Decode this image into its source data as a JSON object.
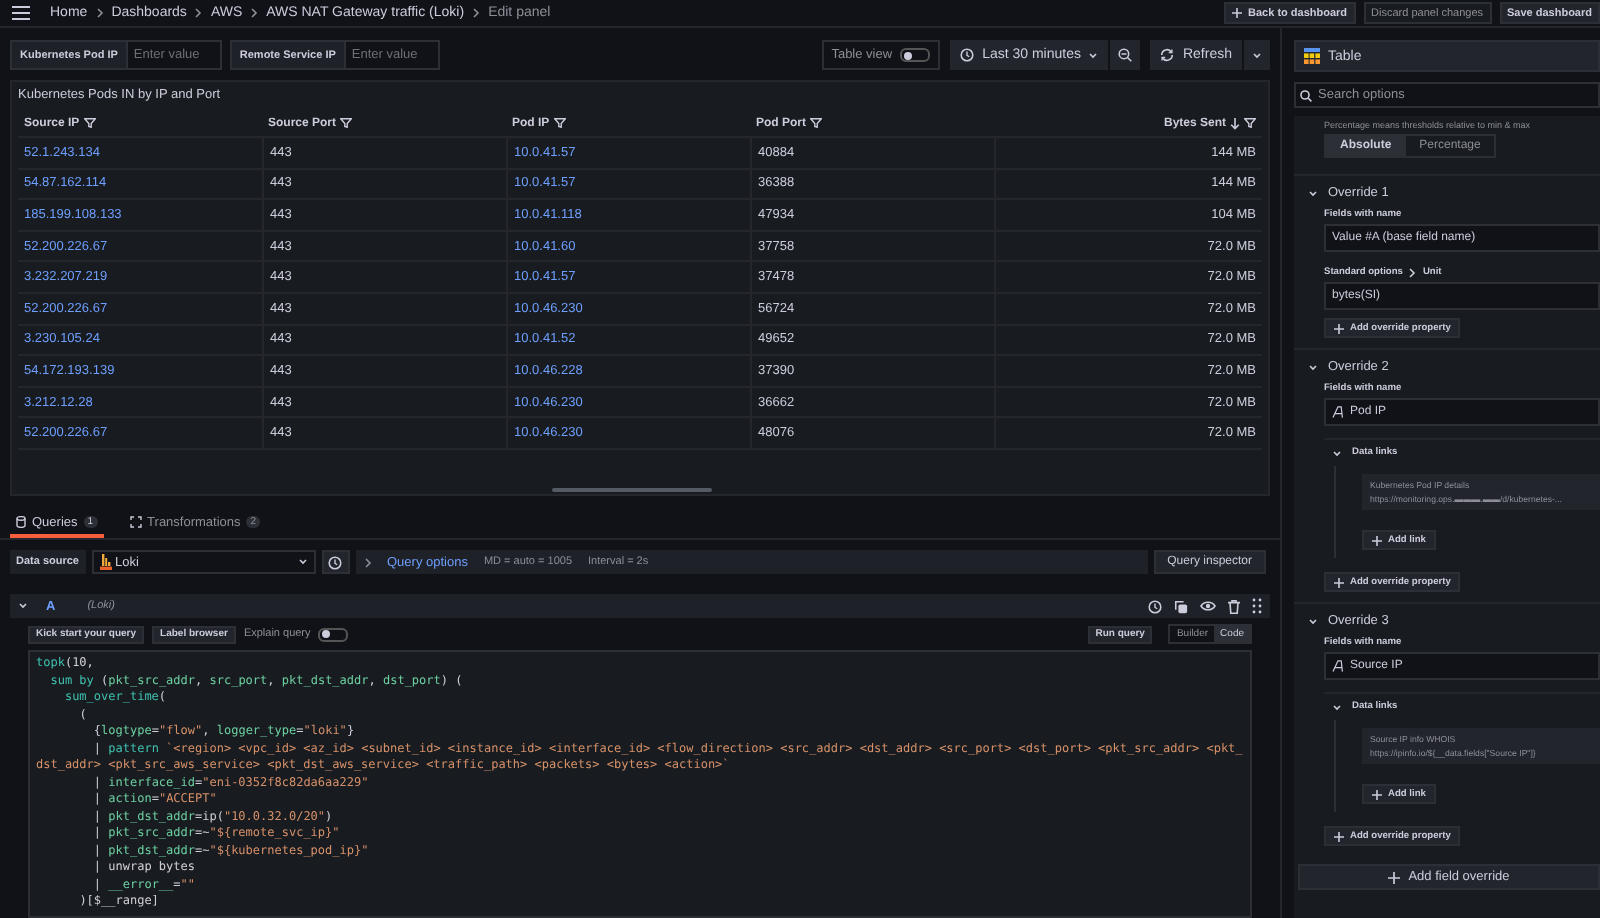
{
  "breadcrumbs": [
    "Home",
    "Dashboards",
    "AWS",
    "AWS NAT Gateway traffic (Loki)",
    "Edit panel"
  ],
  "top_actions": [
    {
      "label": "Back to dashboard",
      "kind": "add"
    },
    {
      "label": "Discard panel changes",
      "kind": "plain"
    },
    {
      "label": "Save dashboard",
      "kind": "plain"
    }
  ],
  "variables": [
    {
      "label": "Kubernetes Pod IP",
      "placeholder": "Enter value"
    },
    {
      "label": "Remote Service IP",
      "placeholder": "Enter value"
    }
  ],
  "table_view": {
    "label": "Table view",
    "on": false
  },
  "time_picker": {
    "label": "Last 30 minutes"
  },
  "refresh": {
    "label": "Refresh"
  },
  "panel": {
    "title": "Kubernetes Pods IN by IP and Port",
    "columns": [
      {
        "label": "Source IP",
        "kind": "link"
      },
      {
        "label": "Source Port",
        "kind": "text"
      },
      {
        "label": "Pod IP",
        "kind": "link"
      },
      {
        "label": "Pod Port",
        "kind": "text"
      },
      {
        "label": "Bytes Sent",
        "kind": "number",
        "sorted_descending": true
      }
    ],
    "rows": [
      [
        "52.1.243.134",
        "443",
        "10.0.41.57",
        "40884",
        "144 MB"
      ],
      [
        "54.87.162.114",
        "443",
        "10.0.41.57",
        "36388",
        "144 MB"
      ],
      [
        "185.199.108.133",
        "443",
        "10.0.41.118",
        "47934",
        "104 MB"
      ],
      [
        "52.200.226.67",
        "443",
        "10.0.41.60",
        "37758",
        "72.0 MB"
      ],
      [
        "3.232.207.219",
        "443",
        "10.0.41.57",
        "37478",
        "72.0 MB"
      ],
      [
        "52.200.226.67",
        "443",
        "10.0.46.230",
        "56724",
        "72.0 MB"
      ],
      [
        "3.230.105.24",
        "443",
        "10.0.41.52",
        "49652",
        "72.0 MB"
      ],
      [
        "54.172.193.139",
        "443",
        "10.0.46.228",
        "37390",
        "72.0 MB"
      ],
      [
        "3.212.12.28",
        "443",
        "10.0.46.230",
        "36662",
        "72.0 MB"
      ],
      [
        "52.200.226.67",
        "443",
        "10.0.46.230",
        "48076",
        "72.0 MB"
      ]
    ]
  },
  "query_tabs": [
    {
      "label": "Queries",
      "count": "1",
      "selected": true
    },
    {
      "label": "Transformations",
      "count": "2",
      "selected": false
    }
  ],
  "data_source": {
    "label": "Data source",
    "value": "Loki",
    "options_link": "Query options",
    "md": "MD = auto = 1005",
    "interval": "Interval = 2s",
    "inspector": "Query inspector"
  },
  "query": {
    "ref": "A",
    "source": "(Loki)",
    "expanded": true,
    "toolbar": {
      "kick_start": "Kick start your query",
      "label_browser": "Label browser",
      "explain": {
        "label": "Explain query",
        "on": false
      },
      "run": "Run query"
    },
    "modes": [
      {
        "label": "Builder",
        "selected": false
      },
      {
        "label": "Code",
        "selected": true
      }
    ],
    "code": [
      [
        {
          "text": "topk",
          "kind": "fn"
        },
        {
          "text": "(10,",
          "kind": "plain"
        }
      ],
      [
        {
          "text": "  sum by",
          "kind": "fn"
        },
        {
          "text": " (",
          "kind": "plain"
        },
        {
          "text": "pkt_src_addr",
          "kind": "label"
        },
        {
          "text": ", ",
          "kind": "plain"
        },
        {
          "text": "src_port",
          "kind": "label"
        },
        {
          "text": ", ",
          "kind": "plain"
        },
        {
          "text": "pkt_dst_addr",
          "kind": "label"
        },
        {
          "text": ", ",
          "kind": "plain"
        },
        {
          "text": "dst_port",
          "kind": "label"
        },
        {
          "text": ") (",
          "kind": "plain"
        }
      ],
      [
        {
          "text": "    sum_over_time",
          "kind": "fn"
        },
        {
          "text": "(",
          "kind": "plain"
        }
      ],
      [
        {
          "text": "      (",
          "kind": "plain"
        }
      ],
      [
        {
          "text": "        {",
          "kind": "plain"
        },
        {
          "text": "logtype",
          "kind": "label"
        },
        {
          "text": "=",
          "kind": "plain"
        },
        {
          "text": "\"flow\"",
          "kind": "str"
        },
        {
          "text": ", ",
          "kind": "plain"
        },
        {
          "text": "logger_type",
          "kind": "label"
        },
        {
          "text": "=",
          "kind": "plain"
        },
        {
          "text": "\"loki\"",
          "kind": "str"
        },
        {
          "text": "}",
          "kind": "plain"
        }
      ],
      [
        {
          "text": "        | ",
          "kind": "plain"
        },
        {
          "text": "pattern",
          "kind": "fn"
        },
        {
          "text": " `<region> <vpc_id> <az_id> <subnet_id> <instance_id> <interface_id> <flow_direction> <src_addr> <dst_addr> <src_port> <dst_port> <pkt_src_addr> <pkt_dst_addr> <pkt_src_aws_service> <pkt_dst_aws_service> <traffic_path> <packets> <bytes> <action>`",
          "kind": "str"
        }
      ],
      [
        {
          "text": "        | ",
          "kind": "plain"
        },
        {
          "text": "interface_id",
          "kind": "label"
        },
        {
          "text": "=",
          "kind": "plain"
        },
        {
          "text": "\"eni-0352f8c82da6aa229\"",
          "kind": "str"
        }
      ],
      [
        {
          "text": "        | ",
          "kind": "plain"
        },
        {
          "text": "action",
          "kind": "label"
        },
        {
          "text": "=",
          "kind": "plain"
        },
        {
          "text": "\"ACCEPT\"",
          "kind": "str"
        }
      ],
      [
        {
          "text": "        | ",
          "kind": "plain"
        },
        {
          "text": "pkt_dst_addr",
          "kind": "label"
        },
        {
          "text": "=ip(",
          "kind": "plain"
        },
        {
          "text": "\"10.0.32.0/20\"",
          "kind": "str"
        },
        {
          "text": ")",
          "kind": "plain"
        }
      ],
      [
        {
          "text": "        | ",
          "kind": "plain"
        },
        {
          "text": "pkt_src_addr",
          "kind": "label"
        },
        {
          "text": "=~",
          "kind": "plain"
        },
        {
          "text": "\"${remote_svc_ip}\"",
          "kind": "str"
        }
      ],
      [
        {
          "text": "        | ",
          "kind": "plain"
        },
        {
          "text": "pkt_dst_addr",
          "kind": "label"
        },
        {
          "text": "=~",
          "kind": "plain"
        },
        {
          "text": "\"${kubernetes_pod_ip}\"",
          "kind": "str"
        }
      ],
      [
        {
          "text": "        | unwrap bytes",
          "kind": "plain"
        }
      ],
      [
        {
          "text": "        | ",
          "kind": "plain"
        },
        {
          "text": "__error__",
          "kind": "label"
        },
        {
          "text": "=",
          "kind": "plain"
        },
        {
          "text": "\"\"",
          "kind": "str"
        }
      ],
      [
        {
          "text": "      )[$__range]",
          "kind": "plain"
        }
      ]
    ]
  },
  "options": {
    "visualization": "Table",
    "search_placeholder": "Search options",
    "thresholds_hint": "Percentage means thresholds relative to min & max",
    "threshold_modes": [
      {
        "label": "Absolute",
        "selected": true
      },
      {
        "label": "Percentage",
        "selected": false
      }
    ],
    "overrides": [
      {
        "title": "Override 1",
        "expanded": true,
        "matcher_label": "Fields with name",
        "matcher": "Value #A (base field name)",
        "field_icon": false,
        "property": {
          "path": [
            "Standard options",
            "Unit"
          ],
          "value": "bytes(SI)"
        },
        "add_property": "Add override property"
      },
      {
        "title": "Override 2",
        "expanded": true,
        "matcher_label": "Fields with name",
        "matcher": "Pod IP",
        "field_icon": true,
        "links": {
          "title": "Data links",
          "expanded": true,
          "items": [
            {
              "title": "Kubernetes Pod IP details",
              "url": "https://monitoring.ops.▬▬▬.▬▬/d/kubernetes-..."
            }
          ],
          "add": "Add link"
        },
        "add_property": "Add override property"
      },
      {
        "title": "Override 3",
        "expanded": true,
        "matcher_label": "Fields with name",
        "matcher": "Source IP",
        "field_icon": true,
        "links": {
          "title": "Data links",
          "expanded": true,
          "items": [
            {
              "title": "Source IP info WHOIS",
              "url": "https://ipinfo.io/${__data.fields[\"Source IP\"]}"
            }
          ],
          "add": "Add link"
        },
        "add_property": "Add override property"
      }
    ],
    "add_override": "Add field override"
  }
}
